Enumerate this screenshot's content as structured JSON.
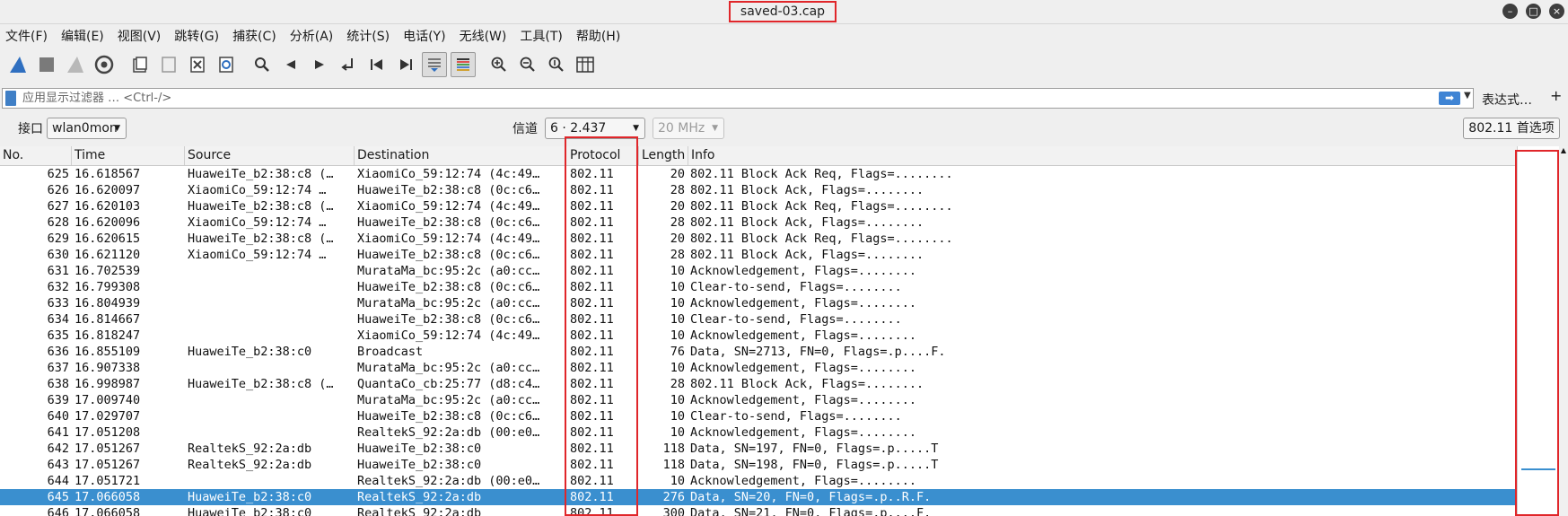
{
  "window": {
    "title": "saved-03.cap"
  },
  "menu": [
    "文件(F)",
    "编辑(E)",
    "视图(V)",
    "跳转(G)",
    "捕获(C)",
    "分析(A)",
    "统计(S)",
    "电话(Y)",
    "无线(W)",
    "工具(T)",
    "帮助(H)"
  ],
  "filter": {
    "placeholder": "应用显示过滤器 … <Ctrl-/>",
    "expression_label": "表达式…",
    "add_label": "+"
  },
  "interface_bar": {
    "interface_label": "接口",
    "interface_value": "wlan0mon",
    "channel_label": "信道",
    "channel_value": "6 · 2.437",
    "width_value": "20 MHz",
    "prefs_label": "802.11 首选项"
  },
  "columns": [
    "No.",
    "Time",
    "Source",
    "Destination",
    "Protocol",
    "Length",
    "Info"
  ],
  "packets": [
    {
      "no": "625",
      "time": "16.618567",
      "src": "HuaweiTe_b2:38:c8 (…",
      "dst": "XiaomiCo_59:12:74 (4c:49…",
      "proto": "802.11",
      "len": "20",
      "info": "802.11 Block Ack Req, Flags=........"
    },
    {
      "no": "626",
      "time": "16.620097",
      "src": "XiaomiCo_59:12:74 …",
      "dst": "HuaweiTe_b2:38:c8 (0c:c6…",
      "proto": "802.11",
      "len": "28",
      "info": "802.11 Block Ack, Flags=........"
    },
    {
      "no": "627",
      "time": "16.620103",
      "src": "HuaweiTe_b2:38:c8 (…",
      "dst": "XiaomiCo_59:12:74 (4c:49…",
      "proto": "802.11",
      "len": "20",
      "info": "802.11 Block Ack Req, Flags=........"
    },
    {
      "no": "628",
      "time": "16.620096",
      "src": "XiaomiCo_59:12:74 …",
      "dst": "HuaweiTe_b2:38:c8 (0c:c6…",
      "proto": "802.11",
      "len": "28",
      "info": "802.11 Block Ack, Flags=........"
    },
    {
      "no": "629",
      "time": "16.620615",
      "src": "HuaweiTe_b2:38:c8 (…",
      "dst": "XiaomiCo_59:12:74 (4c:49…",
      "proto": "802.11",
      "len": "20",
      "info": "802.11 Block Ack Req, Flags=........"
    },
    {
      "no": "630",
      "time": "16.621120",
      "src": "XiaomiCo_59:12:74 …",
      "dst": "HuaweiTe_b2:38:c8 (0c:c6…",
      "proto": "802.11",
      "len": "28",
      "info": "802.11 Block Ack, Flags=........"
    },
    {
      "no": "631",
      "time": "16.702539",
      "src": "",
      "dst": "MurataMa_bc:95:2c (a0:cc…",
      "proto": "802.11",
      "len": "10",
      "info": "Acknowledgement, Flags=........"
    },
    {
      "no": "632",
      "time": "16.799308",
      "src": "",
      "dst": "HuaweiTe_b2:38:c8 (0c:c6…",
      "proto": "802.11",
      "len": "10",
      "info": "Clear-to-send, Flags=........"
    },
    {
      "no": "633",
      "time": "16.804939",
      "src": "",
      "dst": "MurataMa_bc:95:2c (a0:cc…",
      "proto": "802.11",
      "len": "10",
      "info": "Acknowledgement, Flags=........"
    },
    {
      "no": "634",
      "time": "16.814667",
      "src": "",
      "dst": "HuaweiTe_b2:38:c8 (0c:c6…",
      "proto": "802.11",
      "len": "10",
      "info": "Clear-to-send, Flags=........"
    },
    {
      "no": "635",
      "time": "16.818247",
      "src": "",
      "dst": "XiaomiCo_59:12:74 (4c:49…",
      "proto": "802.11",
      "len": "10",
      "info": "Acknowledgement, Flags=........"
    },
    {
      "no": "636",
      "time": "16.855109",
      "src": "HuaweiTe_b2:38:c0",
      "dst": "Broadcast",
      "proto": "802.11",
      "len": "76",
      "info": "Data, SN=2713, FN=0, Flags=.p....F."
    },
    {
      "no": "637",
      "time": "16.907338",
      "src": "",
      "dst": "MurataMa_bc:95:2c (a0:cc…",
      "proto": "802.11",
      "len": "10",
      "info": "Acknowledgement, Flags=........"
    },
    {
      "no": "638",
      "time": "16.998987",
      "src": "HuaweiTe_b2:38:c8 (…",
      "dst": "QuantaCo_cb:25:77 (d8:c4…",
      "proto": "802.11",
      "len": "28",
      "info": "802.11 Block Ack, Flags=........"
    },
    {
      "no": "639",
      "time": "17.009740",
      "src": "",
      "dst": "MurataMa_bc:95:2c (a0:cc…",
      "proto": "802.11",
      "len": "10",
      "info": "Acknowledgement, Flags=........"
    },
    {
      "no": "640",
      "time": "17.029707",
      "src": "",
      "dst": "HuaweiTe_b2:38:c8 (0c:c6…",
      "proto": "802.11",
      "len": "10",
      "info": "Clear-to-send, Flags=........"
    },
    {
      "no": "641",
      "time": "17.051208",
      "src": "",
      "dst": "RealtekS_92:2a:db (00:e0…",
      "proto": "802.11",
      "len": "10",
      "info": "Acknowledgement, Flags=........"
    },
    {
      "no": "642",
      "time": "17.051267",
      "src": "RealtekS_92:2a:db",
      "dst": "HuaweiTe_b2:38:c0",
      "proto": "802.11",
      "len": "118",
      "info": "Data, SN=197, FN=0, Flags=.p.....T"
    },
    {
      "no": "643",
      "time": "17.051267",
      "src": "RealtekS_92:2a:db",
      "dst": "HuaweiTe_b2:38:c0",
      "proto": "802.11",
      "len": "118",
      "info": "Data, SN=198, FN=0, Flags=.p.....T"
    },
    {
      "no": "644",
      "time": "17.051721",
      "src": "",
      "dst": "RealtekS_92:2a:db (00:e0…",
      "proto": "802.11",
      "len": "10",
      "info": "Acknowledgement, Flags=........"
    },
    {
      "no": "645",
      "time": "17.066058",
      "src": "HuaweiTe_b2:38:c0",
      "dst": "RealtekS_92:2a:db",
      "proto": "802.11",
      "len": "276",
      "info": "Data, SN=20, FN=0, Flags=.p..R.F.",
      "selected": true
    },
    {
      "no": "646",
      "time": "17.066058",
      "src": "HuaweiTe_b2:38:c0",
      "dst": "RealtekS_92:2a:db",
      "proto": "802.11",
      "len": "300",
      "info": "Data, SN=21, FN=0, Flags=.p....F."
    }
  ],
  "colors": {
    "selected_row": "#3a8fcf",
    "highlight_box": "#e0262a"
  },
  "icons": [
    "shark-fin-icon",
    "stop-icon",
    "restart-icon",
    "options-gear-icon",
    "open-file-icon",
    "save-file-icon",
    "close-file-icon",
    "reload-icon",
    "find-icon",
    "back-arrow-icon",
    "forward-arrow-icon",
    "goto-packet-icon",
    "first-packet-icon",
    "last-packet-icon",
    "autoscroll-icon",
    "colorize-icon",
    "zoom-in-icon",
    "zoom-out-icon",
    "zoom-reset-icon",
    "resize-columns-icon"
  ]
}
